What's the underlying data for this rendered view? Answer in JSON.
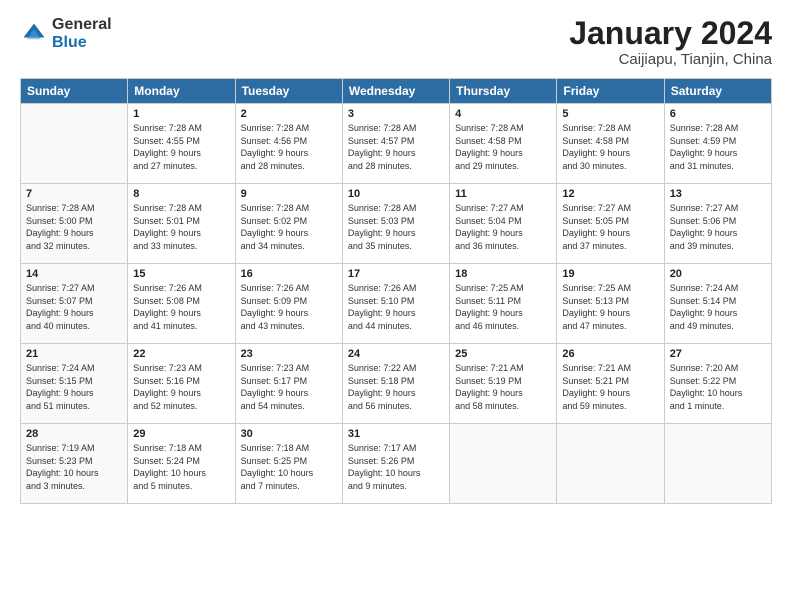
{
  "header": {
    "logo_general": "General",
    "logo_blue": "Blue",
    "month_title": "January 2024",
    "location": "Caijiapu, Tianjin, China"
  },
  "weekdays": [
    "Sunday",
    "Monday",
    "Tuesday",
    "Wednesday",
    "Thursday",
    "Friday",
    "Saturday"
  ],
  "weeks": [
    [
      {
        "day": "",
        "content": ""
      },
      {
        "day": "1",
        "content": "Sunrise: 7:28 AM\nSunset: 4:55 PM\nDaylight: 9 hours\nand 27 minutes."
      },
      {
        "day": "2",
        "content": "Sunrise: 7:28 AM\nSunset: 4:56 PM\nDaylight: 9 hours\nand 28 minutes."
      },
      {
        "day": "3",
        "content": "Sunrise: 7:28 AM\nSunset: 4:57 PM\nDaylight: 9 hours\nand 28 minutes."
      },
      {
        "day": "4",
        "content": "Sunrise: 7:28 AM\nSunset: 4:58 PM\nDaylight: 9 hours\nand 29 minutes."
      },
      {
        "day": "5",
        "content": "Sunrise: 7:28 AM\nSunset: 4:58 PM\nDaylight: 9 hours\nand 30 minutes."
      },
      {
        "day": "6",
        "content": "Sunrise: 7:28 AM\nSunset: 4:59 PM\nDaylight: 9 hours\nand 31 minutes."
      }
    ],
    [
      {
        "day": "7",
        "content": "Sunrise: 7:28 AM\nSunset: 5:00 PM\nDaylight: 9 hours\nand 32 minutes."
      },
      {
        "day": "8",
        "content": "Sunrise: 7:28 AM\nSunset: 5:01 PM\nDaylight: 9 hours\nand 33 minutes."
      },
      {
        "day": "9",
        "content": "Sunrise: 7:28 AM\nSunset: 5:02 PM\nDaylight: 9 hours\nand 34 minutes."
      },
      {
        "day": "10",
        "content": "Sunrise: 7:28 AM\nSunset: 5:03 PM\nDaylight: 9 hours\nand 35 minutes."
      },
      {
        "day": "11",
        "content": "Sunrise: 7:27 AM\nSunset: 5:04 PM\nDaylight: 9 hours\nand 36 minutes."
      },
      {
        "day": "12",
        "content": "Sunrise: 7:27 AM\nSunset: 5:05 PM\nDaylight: 9 hours\nand 37 minutes."
      },
      {
        "day": "13",
        "content": "Sunrise: 7:27 AM\nSunset: 5:06 PM\nDaylight: 9 hours\nand 39 minutes."
      }
    ],
    [
      {
        "day": "14",
        "content": "Sunrise: 7:27 AM\nSunset: 5:07 PM\nDaylight: 9 hours\nand 40 minutes."
      },
      {
        "day": "15",
        "content": "Sunrise: 7:26 AM\nSunset: 5:08 PM\nDaylight: 9 hours\nand 41 minutes."
      },
      {
        "day": "16",
        "content": "Sunrise: 7:26 AM\nSunset: 5:09 PM\nDaylight: 9 hours\nand 43 minutes."
      },
      {
        "day": "17",
        "content": "Sunrise: 7:26 AM\nSunset: 5:10 PM\nDaylight: 9 hours\nand 44 minutes."
      },
      {
        "day": "18",
        "content": "Sunrise: 7:25 AM\nSunset: 5:11 PM\nDaylight: 9 hours\nand 46 minutes."
      },
      {
        "day": "19",
        "content": "Sunrise: 7:25 AM\nSunset: 5:13 PM\nDaylight: 9 hours\nand 47 minutes."
      },
      {
        "day": "20",
        "content": "Sunrise: 7:24 AM\nSunset: 5:14 PM\nDaylight: 9 hours\nand 49 minutes."
      }
    ],
    [
      {
        "day": "21",
        "content": "Sunrise: 7:24 AM\nSunset: 5:15 PM\nDaylight: 9 hours\nand 51 minutes."
      },
      {
        "day": "22",
        "content": "Sunrise: 7:23 AM\nSunset: 5:16 PM\nDaylight: 9 hours\nand 52 minutes."
      },
      {
        "day": "23",
        "content": "Sunrise: 7:23 AM\nSunset: 5:17 PM\nDaylight: 9 hours\nand 54 minutes."
      },
      {
        "day": "24",
        "content": "Sunrise: 7:22 AM\nSunset: 5:18 PM\nDaylight: 9 hours\nand 56 minutes."
      },
      {
        "day": "25",
        "content": "Sunrise: 7:21 AM\nSunset: 5:19 PM\nDaylight: 9 hours\nand 58 minutes."
      },
      {
        "day": "26",
        "content": "Sunrise: 7:21 AM\nSunset: 5:21 PM\nDaylight: 9 hours\nand 59 minutes."
      },
      {
        "day": "27",
        "content": "Sunrise: 7:20 AM\nSunset: 5:22 PM\nDaylight: 10 hours\nand 1 minute."
      }
    ],
    [
      {
        "day": "28",
        "content": "Sunrise: 7:19 AM\nSunset: 5:23 PM\nDaylight: 10 hours\nand 3 minutes."
      },
      {
        "day": "29",
        "content": "Sunrise: 7:18 AM\nSunset: 5:24 PM\nDaylight: 10 hours\nand 5 minutes."
      },
      {
        "day": "30",
        "content": "Sunrise: 7:18 AM\nSunset: 5:25 PM\nDaylight: 10 hours\nand 7 minutes."
      },
      {
        "day": "31",
        "content": "Sunrise: 7:17 AM\nSunset: 5:26 PM\nDaylight: 10 hours\nand 9 minutes."
      },
      {
        "day": "",
        "content": ""
      },
      {
        "day": "",
        "content": ""
      },
      {
        "day": "",
        "content": ""
      }
    ]
  ]
}
